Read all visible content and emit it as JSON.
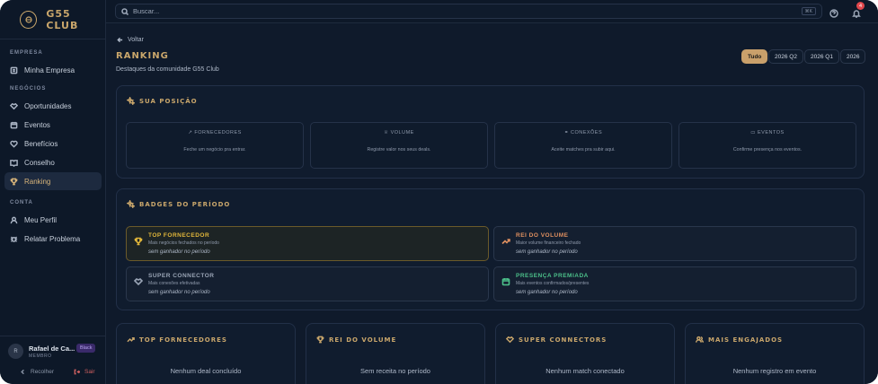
{
  "brand": {
    "name": "G55 CLUB"
  },
  "sidebar": {
    "sections": [
      {
        "title": "EMPRESA",
        "items": [
          {
            "label": "Minha Empresa",
            "icon": "building-icon"
          }
        ]
      },
      {
        "title": "NEGÓCIOS",
        "items": [
          {
            "label": "Oportunidades",
            "icon": "handshake-icon"
          },
          {
            "label": "Eventos",
            "icon": "calendar-icon"
          },
          {
            "label": "Benefícios",
            "icon": "heart-icon"
          },
          {
            "label": "Conselho",
            "icon": "book-icon"
          },
          {
            "label": "Ranking",
            "icon": "trophy-icon",
            "active": true
          }
        ]
      },
      {
        "title": "CONTA",
        "items": [
          {
            "label": "Meu Perfil",
            "icon": "user-icon"
          },
          {
            "label": "Relatar Problema",
            "icon": "bug-icon"
          }
        ]
      }
    ],
    "user": {
      "initial": "R",
      "name": "Rafael de Ca...",
      "role": "MEMBRO",
      "badge": "Black"
    },
    "collapse_label": "Recolher",
    "logout_label": "Sair"
  },
  "topbar": {
    "search_placeholder": "Buscar...",
    "shortcut": "⌘K",
    "notifications_count": "4"
  },
  "page": {
    "back_label": "Voltar",
    "title": "RANKING",
    "subtitle": "Destaques da comunidade G55 Club",
    "periods": [
      {
        "label": "Tudo",
        "active": true
      },
      {
        "label": "2026 Q2"
      },
      {
        "label": "2026 Q1"
      },
      {
        "label": "2026"
      }
    ]
  },
  "position": {
    "title": "SUA POSIÇÃO",
    "stats": [
      {
        "label": "FORNECEDORES",
        "hint": "Feche um negócio pra entrar.",
        "icon": "trend-icon"
      },
      {
        "label": "VOLUME",
        "hint": "Registre valor nos seus deals.",
        "icon": "trophy-icon"
      },
      {
        "label": "CONEXÕES",
        "hint": "Aceite matches pra subir aqui.",
        "icon": "handshake-icon"
      },
      {
        "label": "EVENTOS",
        "hint": "Confirme presença nos eventos.",
        "icon": "calendar-icon"
      }
    ]
  },
  "badges": {
    "title": "BADGES DO PERÍODO",
    "items": [
      {
        "title": "TOP FORNECEDOR",
        "desc": "Mais negócios fechados no período",
        "status": "sem ganhador no período",
        "color": "#e2b73a",
        "icon": "trophy-icon"
      },
      {
        "title": "REI DO VOLUME",
        "desc": "Maior volume financeiro fechado",
        "status": "sem ganhador no período",
        "color": "#e09060",
        "icon": "trend-icon"
      },
      {
        "title": "SUPER CONNECTOR",
        "desc": "Mais conexões efetivadas",
        "status": "sem ganhador no período",
        "color": "#9aa5b6",
        "icon": "handshake-icon"
      },
      {
        "title": "PRESENÇA PREMIADA",
        "desc": "Mais eventos confirmados/presentes",
        "status": "sem ganhador no período",
        "color": "#4cc08a",
        "icon": "calendar-icon"
      }
    ]
  },
  "leaderboards": [
    {
      "title": "TOP FORNECEDORES",
      "empty": "Nenhum deal concluído",
      "icon": "trend-icon"
    },
    {
      "title": "REI DO VOLUME",
      "empty": "Sem receita no período",
      "icon": "trophy-icon"
    },
    {
      "title": "SUPER CONNECTORS",
      "empty": "Nenhum match conectado",
      "icon": "handshake-icon"
    },
    {
      "title": "MAIS ENGAJADOS",
      "empty": "Nenhum registro em evento",
      "icon": "users-icon"
    }
  ]
}
